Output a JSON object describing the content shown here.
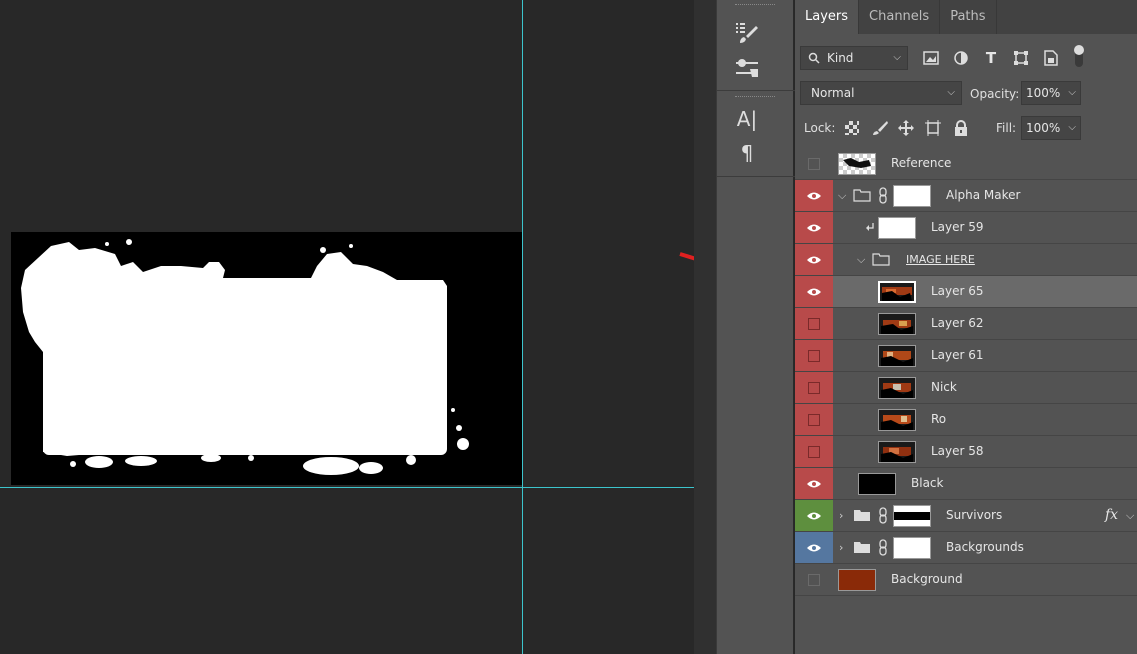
{
  "tool_strip": {
    "icons": [
      "brush-settings-icon",
      "clone-source-icon",
      "character-panel-icon",
      "paragraph-icon"
    ],
    "paragraph_glyph": "¶",
    "character_glyph": "A|"
  },
  "layers_panel": {
    "tabs": [
      {
        "label": "Layers",
        "active": true
      },
      {
        "label": "Channels",
        "active": false
      },
      {
        "label": "Paths",
        "active": false
      }
    ],
    "filter": {
      "label": "Kind"
    },
    "blend_mode": "Normal",
    "opacity_label": "Opacity:",
    "opacity_value": "100%",
    "lock_label": "Lock:",
    "fill_label": "Fill:",
    "fill_value": "100%",
    "layers": [
      {
        "name": "Reference",
        "visible": false,
        "color_tag": "none"
      },
      {
        "name": "Alpha Maker",
        "visible": true,
        "color_tag": "red",
        "type": "group",
        "expanded": true
      },
      {
        "name": "Layer 59",
        "visible": true,
        "color_tag": "red",
        "clipped": true
      },
      {
        "name": "IMAGE HERE",
        "visible": true,
        "color_tag": "red",
        "type": "group",
        "expanded": true
      },
      {
        "name": "Layer 65",
        "visible": true,
        "color_tag": "red",
        "selected": true
      },
      {
        "name": "Layer 62",
        "visible": false,
        "color_tag": "red"
      },
      {
        "name": "Layer 61",
        "visible": false,
        "color_tag": "red"
      },
      {
        "name": "Nick",
        "visible": false,
        "color_tag": "red"
      },
      {
        "name": "Ro",
        "visible": false,
        "color_tag": "red"
      },
      {
        "name": "Layer 58",
        "visible": false,
        "color_tag": "red"
      },
      {
        "name": "Black",
        "visible": true,
        "color_tag": "red"
      },
      {
        "name": "Survivors",
        "visible": true,
        "color_tag": "green",
        "type": "group",
        "expanded": false,
        "fx": "fx"
      },
      {
        "name": "Backgrounds",
        "visible": true,
        "color_tag": "blue",
        "type": "group",
        "expanded": false
      },
      {
        "name": "Background",
        "visible": false,
        "color_tag": "none"
      }
    ]
  },
  "colors": {
    "red_tag": "#b84a4a",
    "green_tag": "#5e8f3e",
    "blue_tag": "#5577a0",
    "guide": "#3cc4cc",
    "arrow": "#e02020",
    "background_swatch": "#8a2a08"
  }
}
